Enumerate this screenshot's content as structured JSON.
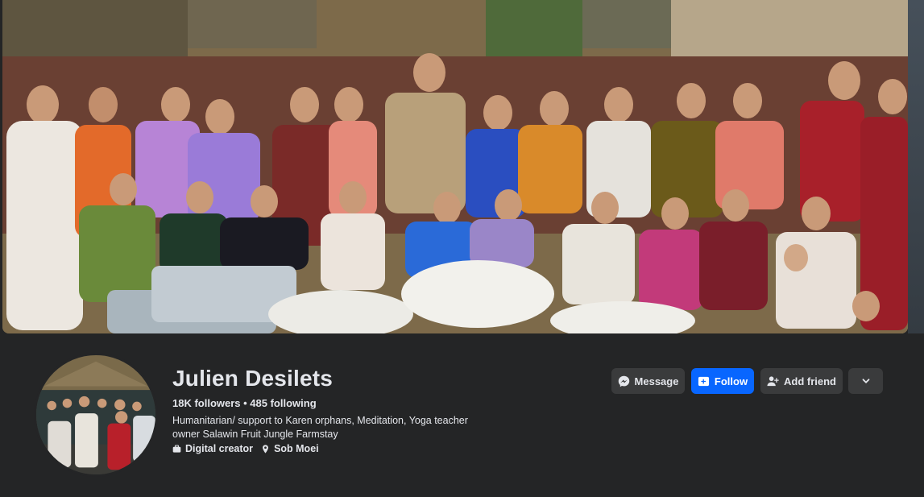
{
  "profile": {
    "name": "Julien Desilets",
    "stats": "18K followers • 485 following",
    "bio_line1": "Humanitarian/ support to Karen orphans, Meditation, Yoga teacher",
    "bio_line2": "owner Salawin Fruit Jungle Farmstay",
    "category": "Digital creator",
    "location": "Sob Moei"
  },
  "actions": {
    "message_label": "Message",
    "follow_label": "Follow",
    "add_friend_label": "Add friend"
  },
  "icons": {
    "message": "messenger-icon",
    "follow": "follow-icon",
    "add_friend": "add-friend-icon",
    "more": "chevron-down-icon",
    "category": "briefcase-icon",
    "location": "location-pin-icon"
  },
  "colors": {
    "background": "#242526",
    "button": "#3a3b3c",
    "accent": "#0866ff",
    "text": "#e4e6eb"
  }
}
